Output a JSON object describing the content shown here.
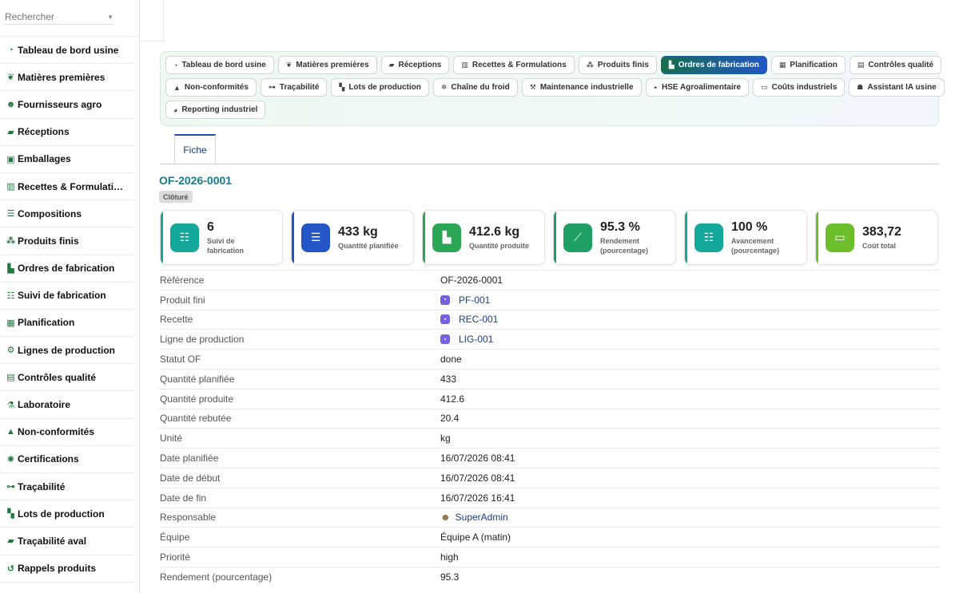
{
  "search": {
    "placeholder": "Rechercher"
  },
  "sidebar": {
    "items": [
      {
        "label": "Tableau de bord usine",
        "icon": "gauge-icon"
      },
      {
        "label": "Matières premières",
        "icon": "seedling-icon"
      },
      {
        "label": "Fournisseurs agro",
        "icon": "users-icon"
      },
      {
        "label": "Réceptions",
        "icon": "truck-icon"
      },
      {
        "label": "Emballages",
        "icon": "gift-icon"
      },
      {
        "label": "Recettes & Formulati…",
        "icon": "book-icon"
      },
      {
        "label": "Compositions",
        "icon": "list-icon"
      },
      {
        "label": "Produits finis",
        "icon": "cubes-icon"
      },
      {
        "label": "Ordres de fabrication",
        "icon": "industry-icon"
      },
      {
        "label": "Suivi de fabrication",
        "icon": "list-check-icon"
      },
      {
        "label": "Planification",
        "icon": "calendar-icon"
      },
      {
        "label": "Lignes de production",
        "icon": "cogs-icon"
      },
      {
        "label": "Contrôles qualité",
        "icon": "clipboard-check-icon"
      },
      {
        "label": "Laboratoire",
        "icon": "flask-icon"
      },
      {
        "label": "Non-conformités",
        "icon": "warning-icon"
      },
      {
        "label": "Certifications",
        "icon": "certificate-icon"
      },
      {
        "label": "Traçabilité",
        "icon": "sitemap-icon"
      },
      {
        "label": "Lots de production",
        "icon": "boxes-icon"
      },
      {
        "label": "Traçabilité aval",
        "icon": "truck-icon"
      },
      {
        "label": "Rappels produits",
        "icon": "undo-icon"
      }
    ]
  },
  "tabs": {
    "rows": [
      [
        {
          "label": "Tableau de bord usine",
          "icon": "gauge-icon"
        },
        {
          "label": "Matières premières",
          "icon": "seedling-icon"
        },
        {
          "label": "Réceptions",
          "icon": "truck-icon"
        },
        {
          "label": "Recettes & Formulations",
          "icon": "book-icon"
        },
        {
          "label": "Produits finis",
          "icon": "cubes-icon"
        },
        {
          "label": "Ordres de fabrication",
          "icon": "industry-icon",
          "active": true
        },
        {
          "label": "Planification",
          "icon": "calendar-icon"
        },
        {
          "label": "Contrôles qualité",
          "icon": "clipboard-check-icon"
        }
      ],
      [
        {
          "label": "Non-conformités",
          "icon": "warning-icon"
        },
        {
          "label": "Traçabilité",
          "icon": "sitemap-icon"
        },
        {
          "label": "Lots de production",
          "icon": "boxes-icon"
        },
        {
          "label": "Chaîne du froid",
          "icon": "snowflake-icon"
        },
        {
          "label": "Maintenance industrielle",
          "icon": "wrench-icon"
        },
        {
          "label": "HSE Agroalimentaire",
          "icon": "hardhat-icon"
        },
        {
          "label": "Coûts industriels",
          "icon": "money-icon"
        },
        {
          "label": "Assistant IA usine",
          "icon": "robot-icon"
        }
      ],
      [
        {
          "label": "Reporting industriel",
          "icon": "chart-pie-icon"
        }
      ]
    ]
  },
  "record": {
    "tab_label": "Fiche",
    "title": "OF-2026-0001",
    "status": "Clôturé"
  },
  "kpis": [
    {
      "value": "6",
      "label": "Suivi de fabrication",
      "color": "#14a89a",
      "icon": "list-check-icon"
    },
    {
      "value": "433 kg",
      "label": "Quantité planifiée",
      "color": "#2456c8",
      "icon": "clipboard-list-icon"
    },
    {
      "value": "412.6 kg",
      "label": "Quantité produite",
      "color": "#2aa655",
      "icon": "industry-icon"
    },
    {
      "value": "95.3 %",
      "label": "Rendement (pourcentage)",
      "color": "#1f9f63",
      "icon": "chart-line-icon"
    },
    {
      "value": "100 %",
      "label": "Avancement (pourcentage)",
      "color": "#14a89a",
      "icon": "list-check-icon"
    },
    {
      "value": "383,72",
      "label": "Coût total",
      "color": "#6cbf2a",
      "icon": "money-bill-icon"
    }
  ],
  "details": [
    {
      "label": "Référence",
      "value": "OF-2026-0001"
    },
    {
      "label": "Produit fini",
      "value": "PF-001",
      "link": true,
      "icon": "record-icon"
    },
    {
      "label": "Recette",
      "value": "REC-001",
      "link": true,
      "icon": "record-icon"
    },
    {
      "label": "Ligne de production",
      "value": "LIG-001",
      "link": true,
      "icon": "record-icon"
    },
    {
      "label": "Statut OF",
      "value": "done"
    },
    {
      "label": "Quantité planifiée",
      "value": "433"
    },
    {
      "label": "Quantité produite",
      "value": "412.6"
    },
    {
      "label": "Quantité rebutée",
      "value": "20.4"
    },
    {
      "label": "Unité",
      "value": "kg"
    },
    {
      "label": "Date planifiée",
      "value": "16/07/2026 08:41"
    },
    {
      "label": "Date de début",
      "value": "16/07/2026 08:41"
    },
    {
      "label": "Date de fin",
      "value": "16/07/2026 16:41"
    },
    {
      "label": "Responsable",
      "value": "SuperAdmin",
      "link": true,
      "icon": "user-icon"
    },
    {
      "label": "Équipe",
      "value": "Équipe A (matin)"
    },
    {
      "label": "Priorité",
      "value": "high"
    },
    {
      "label": "Rendement (pourcentage)",
      "value": "95.3"
    }
  ]
}
